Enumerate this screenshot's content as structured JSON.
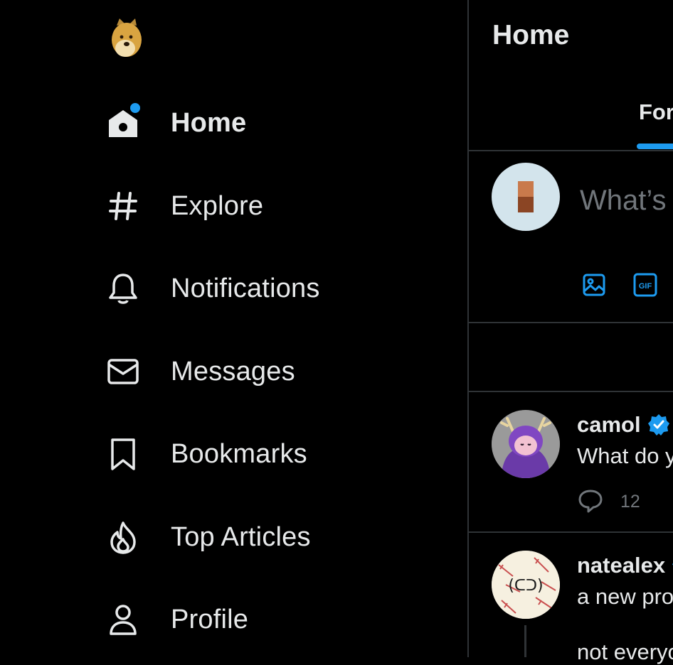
{
  "sidebar": {
    "logo_alt": "Doge logo",
    "items": [
      {
        "label": "Home",
        "icon": "home-icon",
        "active": true
      },
      {
        "label": "Explore",
        "icon": "hashtag-icon"
      },
      {
        "label": "Notifications",
        "icon": "bell-icon"
      },
      {
        "label": "Messages",
        "icon": "envelope-icon"
      },
      {
        "label": "Bookmarks",
        "icon": "bookmark-icon"
      },
      {
        "label": "Top Articles",
        "icon": "flame-icon"
      },
      {
        "label": "Profile",
        "icon": "person-icon"
      }
    ]
  },
  "main": {
    "title": "Home",
    "tabs": [
      {
        "label": "For",
        "active": true
      }
    ],
    "compose": {
      "placeholder": "What’s"
    },
    "tweets": [
      {
        "author": "camol",
        "verified": true,
        "text": "What do y",
        "reply_count": "12"
      },
      {
        "author": "natealex",
        "verified": true,
        "text_line1": "a new proj",
        "text_line2": "not everyo"
      }
    ]
  },
  "colors": {
    "accent": "#1d9bf0",
    "background": "#000000",
    "text": "#e7e9ea",
    "muted": "#71767b",
    "border": "#2f3336"
  }
}
